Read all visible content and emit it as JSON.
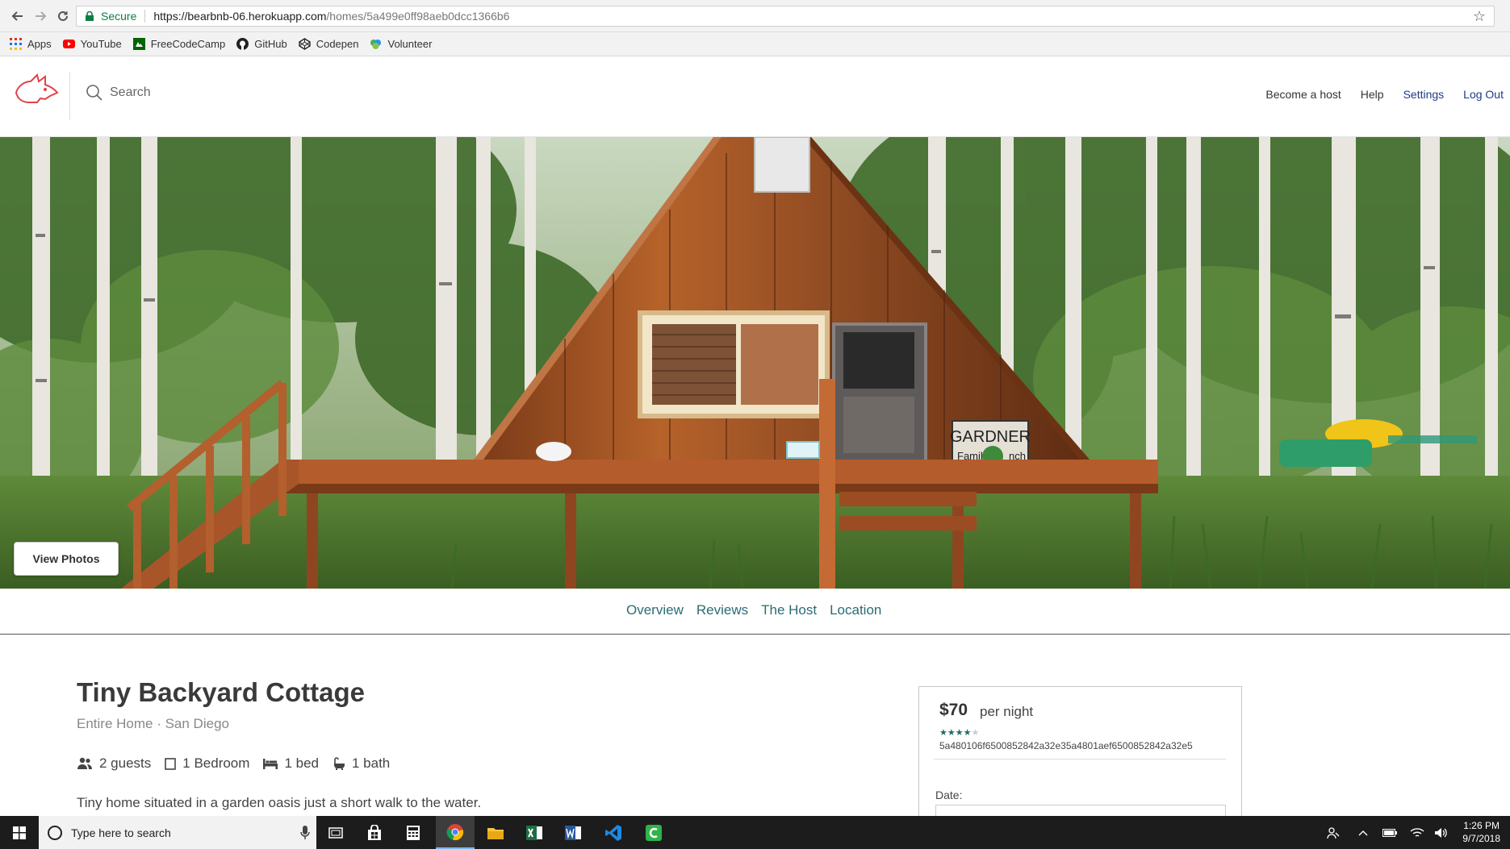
{
  "browser": {
    "secure_label": "Secure",
    "url_host": "https://bearbnb-06.herokuapp.com",
    "url_path": "/homes/5a499e0ff98aeb0dcc1366b6",
    "bookmarks": [
      {
        "label": "Apps",
        "icon": "apps-grid-icon",
        "color": "#d93025"
      },
      {
        "label": "YouTube",
        "icon": "youtube-icon",
        "color": "#ff0000"
      },
      {
        "label": "FreeCodeCamp",
        "icon": "freecodecamp-icon",
        "color": "#006400"
      },
      {
        "label": "GitHub",
        "icon": "github-icon",
        "color": "#222222"
      },
      {
        "label": "Codepen",
        "icon": "codepen-icon",
        "color": "#222222"
      },
      {
        "label": "Volunteer",
        "icon": "volunteer-icon",
        "color": "#4caf50"
      }
    ]
  },
  "header": {
    "search_placeholder": "Search",
    "nav": {
      "become_host": "Become a host",
      "help": "Help",
      "settings": "Settings",
      "logout": "Log Out"
    },
    "logo_color": "#e0434b",
    "link_color": "#1e3a8a"
  },
  "hero": {
    "view_photos_label": "View Photos",
    "sign_text_1": "GARDNER",
    "sign_text_2": "Famil",
    "sign_text_3": "nch"
  },
  "section_tabs": [
    "Overview",
    "Reviews",
    "The Host",
    "Location"
  ],
  "listing": {
    "title": "Tiny Backyard Cottage",
    "subtitle": "Entire Home · San Diego",
    "amenities": {
      "guests": "2 guests",
      "bedrooms": "1 Bedroom",
      "beds": "1 bed",
      "baths": "1 bath"
    },
    "description": "Tiny home situated in a garden oasis just a short walk to the water."
  },
  "booking": {
    "price": "$70",
    "per_night": "per night",
    "rating": 4,
    "rating_max": 5,
    "stars_on": "★★★★",
    "stars_off": "★",
    "listing_id": "5a480106f6500852842a32e35a4801aef6500852842a32e5",
    "date_label": "Date:"
  },
  "taskbar": {
    "search_placeholder": "Type here to search",
    "time": "1:26 PM",
    "date": "9/7/2018"
  },
  "colors": {
    "accent_teal": "#2b6b73",
    "secure_green": "#0b8043"
  }
}
